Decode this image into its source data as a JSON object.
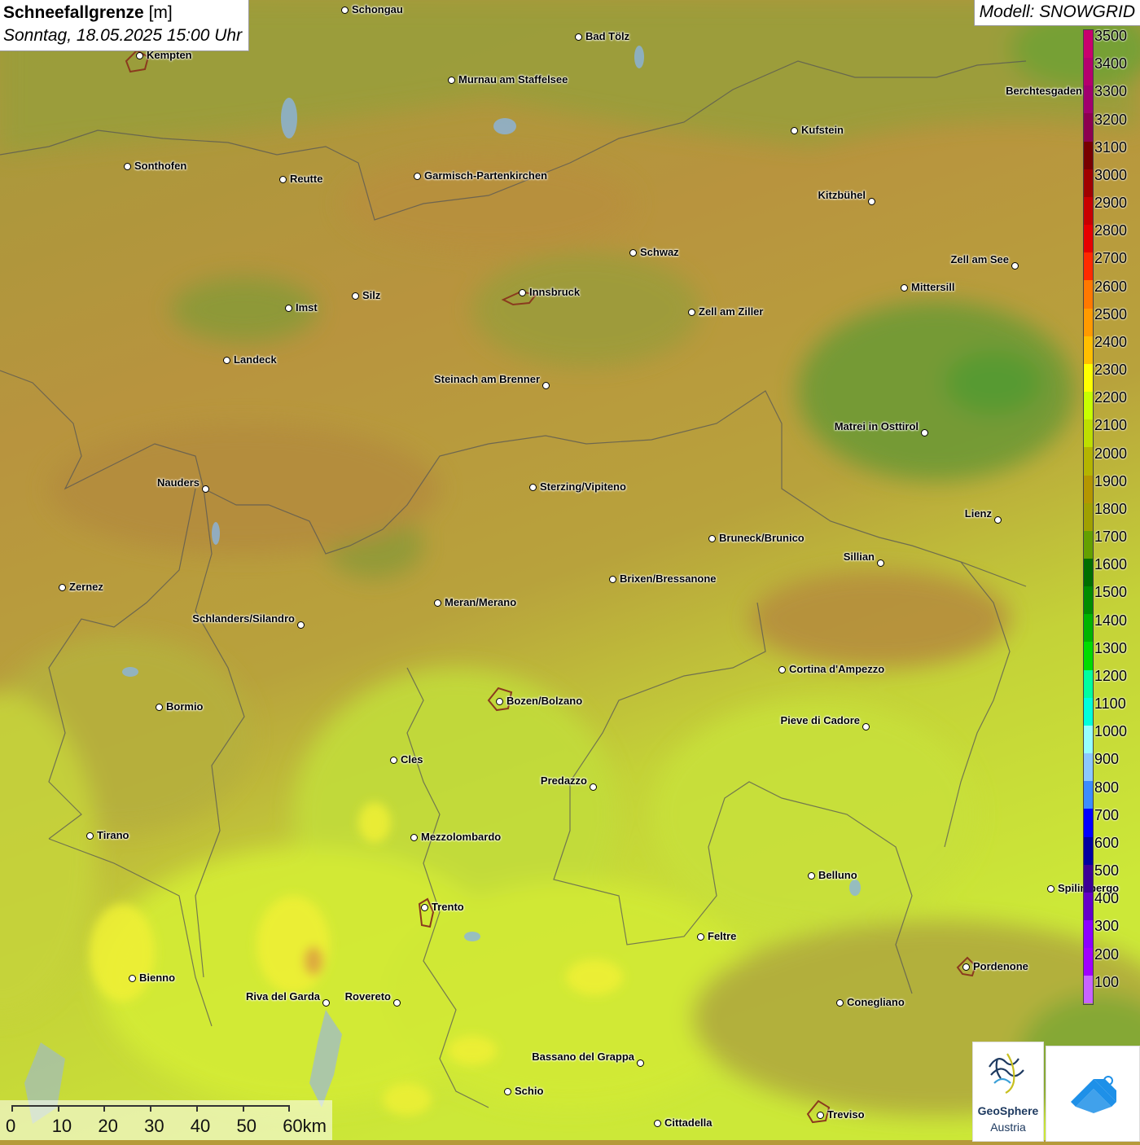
{
  "title": {
    "parameter": "Schneefallgrenze",
    "unit": "[m]",
    "datetime": "Sonntag, 18.05.2025 15:00 Uhr"
  },
  "model_label": "Modell: SNOWGRID",
  "legend": {
    "values": [
      "3500",
      "3400",
      "3300",
      "3200",
      "3100",
      "3000",
      "2900",
      "2800",
      "2700",
      "2600",
      "2500",
      "2400",
      "2300",
      "2200",
      "2100",
      "2000",
      "1900",
      "1800",
      "1700",
      "1600",
      "1500",
      "1400",
      "1300",
      "1200",
      "1100",
      "1000",
      "900",
      "800",
      "700",
      "600",
      "500",
      "400",
      "300",
      "200",
      "100"
    ],
    "colors": [
      "#c8006e",
      "#b4006e",
      "#a0006e",
      "#8c0050",
      "#780000",
      "#a00000",
      "#c80000",
      "#e60000",
      "#ff2a00",
      "#ff7800",
      "#ff9a00",
      "#ffbe00",
      "#ffff00",
      "#c8ff00",
      "#bede00",
      "#b4b400",
      "#b49600",
      "#a0a000",
      "#64a000",
      "#006e00",
      "#008c00",
      "#00b400",
      "#00dc00",
      "#00ffa0",
      "#00ffdc",
      "#96ffff",
      "#8cc8ff",
      "#3c8cff",
      "#0000ff",
      "#0000a0",
      "#3c0096",
      "#6400c8",
      "#8c00ff",
      "#a000ff",
      "#c864ff"
    ]
  },
  "cities": [
    {
      "name": "Schongau"
    },
    {
      "name": "Bad Tölz"
    },
    {
      "name": "Kempten"
    },
    {
      "name": "Murnau am Staffelsee"
    },
    {
      "name": "Berchtesgaden"
    },
    {
      "name": "Kufstein"
    },
    {
      "name": "Sonthofen"
    },
    {
      "name": "Reutte"
    },
    {
      "name": "Garmisch-Partenkirchen"
    },
    {
      "name": "Kitzbühel"
    },
    {
      "name": "Schwaz"
    },
    {
      "name": "Zell am See"
    },
    {
      "name": "Innsbruck"
    },
    {
      "name": "Mittersill"
    },
    {
      "name": "Silz"
    },
    {
      "name": "Imst"
    },
    {
      "name": "Zell am Ziller"
    },
    {
      "name": "Landeck"
    },
    {
      "name": "Steinach am Brenner"
    },
    {
      "name": "Matrei in Osttirol"
    },
    {
      "name": "Nauders"
    },
    {
      "name": "Sterzing/Vipiteno"
    },
    {
      "name": "Lienz"
    },
    {
      "name": "Bruneck/Brunico"
    },
    {
      "name": "Sillian"
    },
    {
      "name": "Zernez"
    },
    {
      "name": "Brixen/Bressanone"
    },
    {
      "name": "Meran/Merano"
    },
    {
      "name": "Schlanders/Silandro"
    },
    {
      "name": "Cortina d'Ampezzo"
    },
    {
      "name": "Bormio"
    },
    {
      "name": "Bozen/Bolzano"
    },
    {
      "name": "Pieve di Cadore"
    },
    {
      "name": "Cles"
    },
    {
      "name": "Predazzo"
    },
    {
      "name": "Tirano"
    },
    {
      "name": "Mezzolombardo"
    },
    {
      "name": "Belluno"
    },
    {
      "name": "Spilimbergo"
    },
    {
      "name": "Trento"
    },
    {
      "name": "Feltre"
    },
    {
      "name": "Pordenone"
    },
    {
      "name": "Bienno"
    },
    {
      "name": "Riva del Garda"
    },
    {
      "name": "Rovereto"
    },
    {
      "name": "Conegliano"
    },
    {
      "name": "Bassano del Grappa"
    },
    {
      "name": "Schio"
    },
    {
      "name": "Treviso"
    },
    {
      "name": "Cittadella"
    }
  ],
  "scale": {
    "labels": [
      "0",
      "10",
      "20",
      "30",
      "40",
      "50",
      "60km"
    ]
  },
  "logos": {
    "geosphere_line1": "GeoSphere",
    "geosphere_line2": "Austria"
  },
  "colors": {
    "mountain_brown": "#b8963c",
    "valley_green": "#7a9a30",
    "lowland_lime": "#c8e63c",
    "yellow": "#f0f032"
  }
}
